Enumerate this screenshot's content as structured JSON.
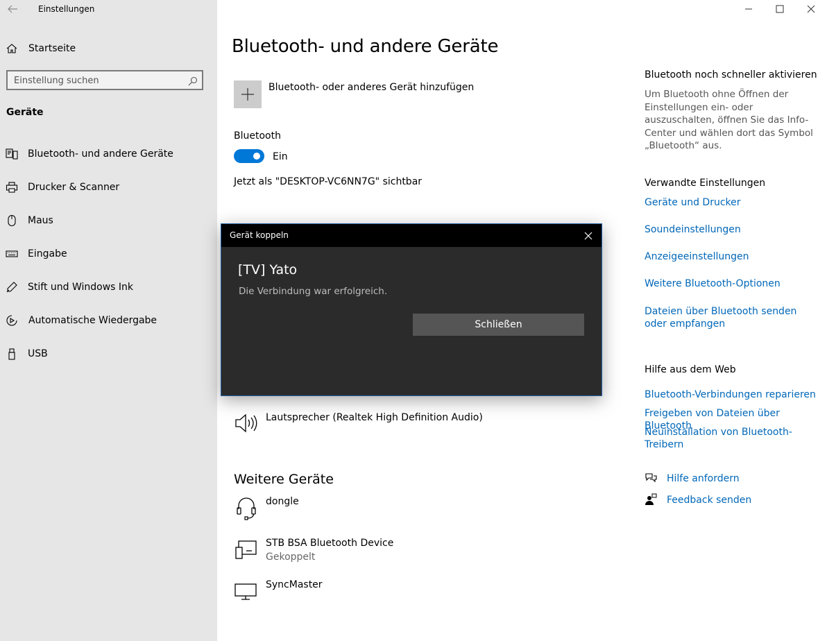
{
  "app": {
    "title": "Einstellungen"
  },
  "sidebar": {
    "home_label": "Startseite",
    "search_placeholder": "Einstellung suchen",
    "section_title": "Geräte",
    "items": [
      {
        "label": "Bluetooth- und andere Geräte",
        "icon": "bluetooth-devices-icon"
      },
      {
        "label": "Drucker & Scanner",
        "icon": "printer-icon"
      },
      {
        "label": "Maus",
        "icon": "mouse-icon"
      },
      {
        "label": "Eingabe",
        "icon": "keyboard-icon"
      },
      {
        "label": "Stift und Windows Ink",
        "icon": "pen-icon"
      },
      {
        "label": "Automatische Wiedergabe",
        "icon": "autoplay-icon"
      },
      {
        "label": "USB",
        "icon": "usb-icon"
      }
    ]
  },
  "main": {
    "title": "Bluetooth- und andere Geräte",
    "add_device_label": "Bluetooth- oder anderes Gerät hinzufügen",
    "bluetooth_label": "Bluetooth",
    "toggle_state": "Ein",
    "visible_as": "Jetzt als \"DESKTOP-VC6NN7G\" sichtbar",
    "audio_device": "Lautsprecher (Realtek High Definition Audio)",
    "other_devices_title": "Weitere Geräte",
    "other_devices": [
      {
        "name": "dongle",
        "status": ""
      },
      {
        "name": "STB BSA Bluetooth Device",
        "status": "Gekoppelt"
      },
      {
        "name": "SyncMaster",
        "status": ""
      }
    ]
  },
  "right": {
    "quick_title": "Bluetooth noch schneller aktivieren",
    "quick_text": "Um Bluetooth ohne Öffnen der Einstellungen ein- oder auszuschalten, öffnen Sie das Info-Center und wählen dort das Symbol „Bluetooth“ aus.",
    "related_title": "Verwandte Einstellungen",
    "related_links": [
      "Geräte und Drucker",
      "Soundeinstellungen",
      "Anzeigeeinstellungen",
      "Weitere Bluetooth-Optionen",
      "Dateien über Bluetooth senden oder empfangen"
    ],
    "web_title": "Hilfe aus dem Web",
    "web_links": [
      "Bluetooth-Verbindungen reparieren",
      "Freigeben von Dateien über Bluetooth",
      "Neuinstallation von Bluetooth-Treibern"
    ],
    "help_label": "Hilfe anfordern",
    "feedback_label": "Feedback senden"
  },
  "dialog": {
    "title": "Gerät koppeln",
    "device": "[TV] Yato",
    "message": "Die Verbindung war erfolgreich.",
    "button": "Schließen"
  },
  "colors": {
    "accent": "#0078d7",
    "link": "#0067b8",
    "sidebar_bg": "#e6e6e6",
    "dialog_bg": "#2b2b2b"
  }
}
